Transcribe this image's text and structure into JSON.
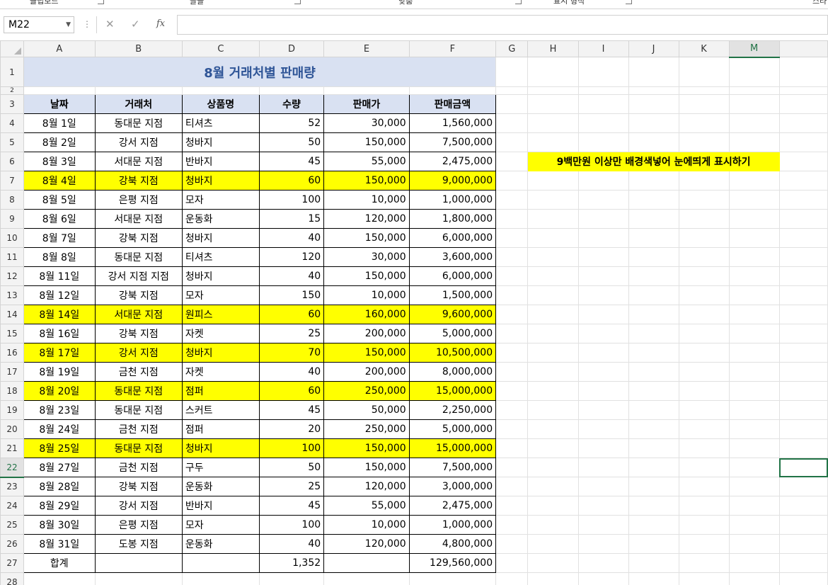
{
  "ribbon": {
    "groups": [
      "클립보드",
      "글꼴",
      "맞춤",
      "표시 형식",
      "스타"
    ]
  },
  "formula_bar": {
    "name_box": "M22",
    "cancel_icon": "✕",
    "enter_icon": "✓",
    "fx_label": "fx",
    "formula": ""
  },
  "columns": [
    "A",
    "B",
    "C",
    "D",
    "E",
    "F",
    "G",
    "H",
    "I",
    "J",
    "K",
    "L",
    "M"
  ],
  "title": "8월 거래처별 판매량",
  "headers": [
    "날짜",
    "거래처",
    "상품명",
    "수량",
    "판매가",
    "판매금액"
  ],
  "rows": [
    {
      "date": "8월 1일",
      "client": "동대문 지점",
      "product": "티셔츠",
      "qty": "52",
      "price": "30,000",
      "amount": "1,560,000",
      "highlight": false
    },
    {
      "date": "8월 2일",
      "client": "강서 지점",
      "product": "청바지",
      "qty": "50",
      "price": "150,000",
      "amount": "7,500,000",
      "highlight": false
    },
    {
      "date": "8월 3일",
      "client": "서대문 지점",
      "product": "반바지",
      "qty": "45",
      "price": "55,000",
      "amount": "2,475,000",
      "highlight": false
    },
    {
      "date": "8월 4일",
      "client": "강북 지점",
      "product": "청바지",
      "qty": "60",
      "price": "150,000",
      "amount": "9,000,000",
      "highlight": true
    },
    {
      "date": "8월 5일",
      "client": "은평 지점",
      "product": "모자",
      "qty": "100",
      "price": "10,000",
      "amount": "1,000,000",
      "highlight": false
    },
    {
      "date": "8월 6일",
      "client": "서대문 지점",
      "product": "운동화",
      "qty": "15",
      "price": "120,000",
      "amount": "1,800,000",
      "highlight": false
    },
    {
      "date": "8월 7일",
      "client": "강북 지점",
      "product": "청바지",
      "qty": "40",
      "price": "150,000",
      "amount": "6,000,000",
      "highlight": false
    },
    {
      "date": "8월 8일",
      "client": "동대문 지점",
      "product": "티셔츠",
      "qty": "120",
      "price": "30,000",
      "amount": "3,600,000",
      "highlight": false
    },
    {
      "date": "8월 11일",
      "client": "강서 지점 지점",
      "product": "청바지",
      "qty": "40",
      "price": "150,000",
      "amount": "6,000,000",
      "highlight": false
    },
    {
      "date": "8월 12일",
      "client": "강북 지점",
      "product": "모자",
      "qty": "150",
      "price": "10,000",
      "amount": "1,500,000",
      "highlight": false
    },
    {
      "date": "8월 14일",
      "client": "서대문 지점",
      "product": "원피스",
      "qty": "60",
      "price": "160,000",
      "amount": "9,600,000",
      "highlight": true
    },
    {
      "date": "8월 16일",
      "client": "강북 지점",
      "product": "자켓",
      "qty": "25",
      "price": "200,000",
      "amount": "5,000,000",
      "highlight": false
    },
    {
      "date": "8월 17일",
      "client": "강서 지점",
      "product": "청바지",
      "qty": "70",
      "price": "150,000",
      "amount": "10,500,000",
      "highlight": true
    },
    {
      "date": "8월 19일",
      "client": "금천 지점",
      "product": "자켓",
      "qty": "40",
      "price": "200,000",
      "amount": "8,000,000",
      "highlight": false
    },
    {
      "date": "8월 20일",
      "client": "동대문 지점",
      "product": "점퍼",
      "qty": "60",
      "price": "250,000",
      "amount": "15,000,000",
      "highlight": true
    },
    {
      "date": "8월 23일",
      "client": "동대문 지점",
      "product": "스커트",
      "qty": "45",
      "price": "50,000",
      "amount": "2,250,000",
      "highlight": false
    },
    {
      "date": "8월 24일",
      "client": "금천 지점",
      "product": "점퍼",
      "qty": "20",
      "price": "250,000",
      "amount": "5,000,000",
      "highlight": false
    },
    {
      "date": "8월 25일",
      "client": "동대문 지점",
      "product": "청바지",
      "qty": "100",
      "price": "150,000",
      "amount": "15,000,000",
      "highlight": true
    },
    {
      "date": "8월 27일",
      "client": "금천 지점",
      "product": "구두",
      "qty": "50",
      "price": "150,000",
      "amount": "7,500,000",
      "highlight": false
    },
    {
      "date": "8월 28일",
      "client": "강북 지점",
      "product": "운동화",
      "qty": "25",
      "price": "120,000",
      "amount": "3,000,000",
      "highlight": false
    },
    {
      "date": "8월 29일",
      "client": "강서 지점",
      "product": "반바지",
      "qty": "45",
      "price": "55,000",
      "amount": "2,475,000",
      "highlight": false
    },
    {
      "date": "8월 30일",
      "client": "은평 지점",
      "product": "모자",
      "qty": "100",
      "price": "10,000",
      "amount": "1,000,000",
      "highlight": false
    },
    {
      "date": "8월 31일",
      "client": "도봉 지점",
      "product": "운동화",
      "qty": "40",
      "price": "120,000",
      "amount": "4,800,000",
      "highlight": false
    }
  ],
  "total": {
    "label": "합계",
    "qty": "1,352",
    "amount": "129,560,000"
  },
  "note": "9백만원 이상만 배경색넣어 눈에띄게 표시하기",
  "colors": {
    "title_bg": "#d9e1f2",
    "title_text": "#2f5597",
    "highlight": "#ffff00",
    "selection": "#217346"
  }
}
